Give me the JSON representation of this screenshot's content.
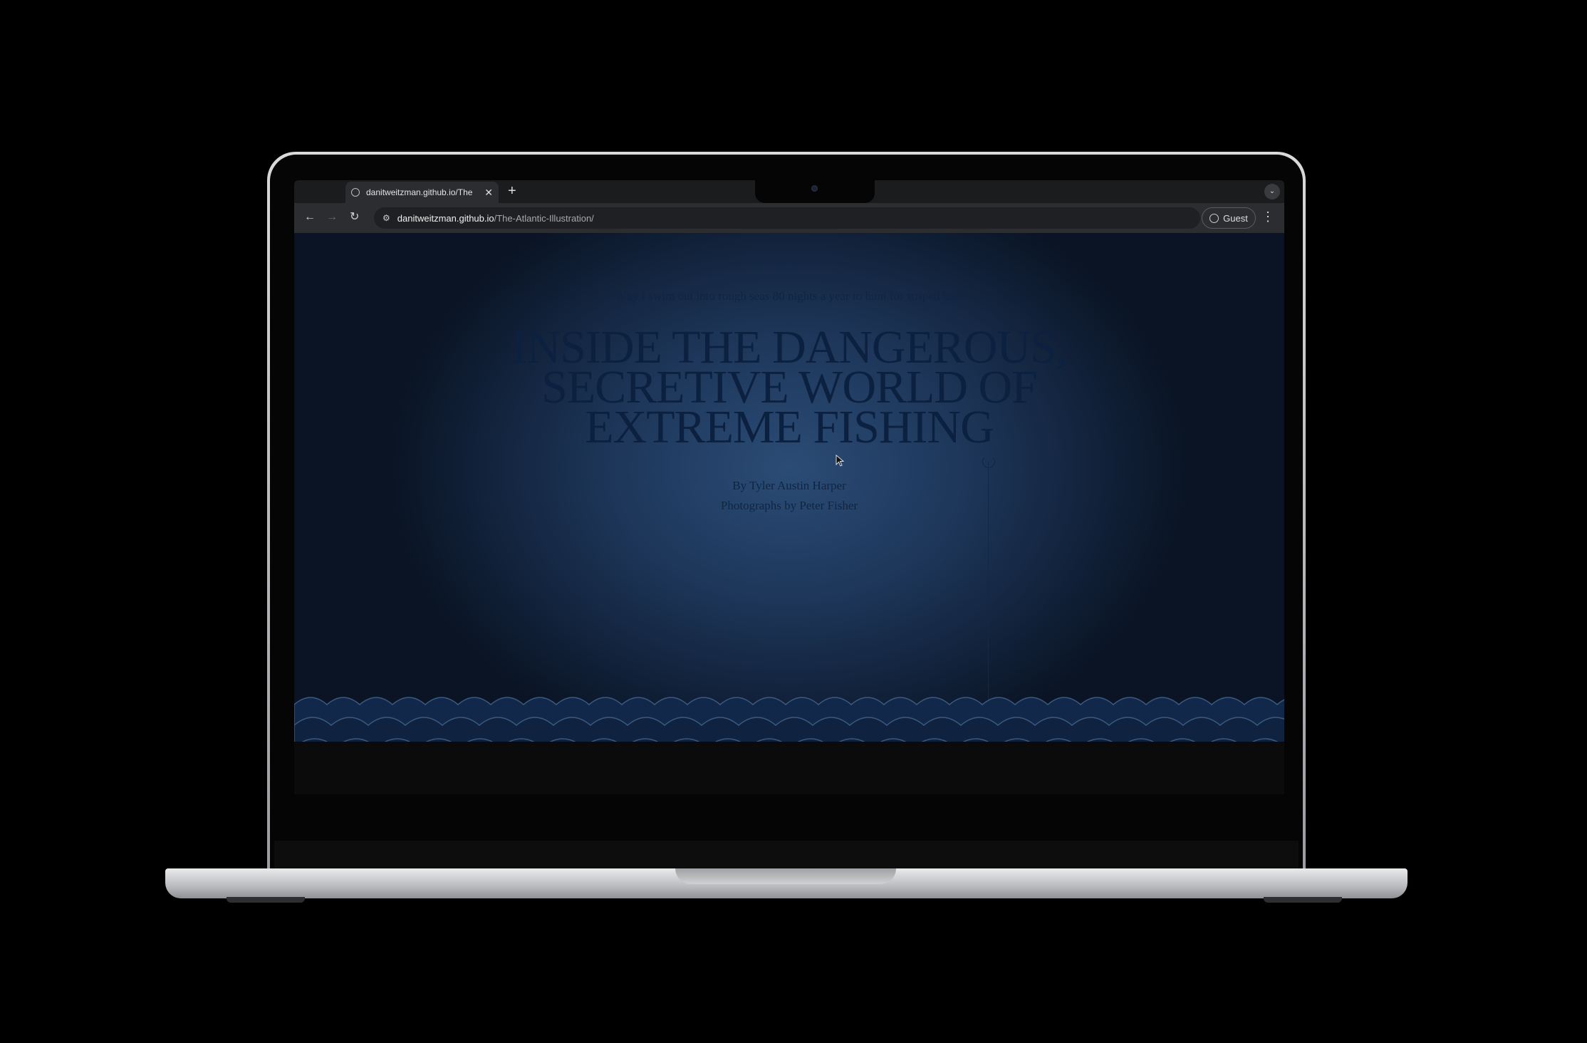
{
  "browser": {
    "tab_title": "danitweitzman.github.io/The",
    "new_tab_label": "+",
    "url_host": "danitweitzman.github.io",
    "url_path": "/The-Atlantic-Illustration/",
    "profile_label": "Guest"
  },
  "article": {
    "dek": "Why I swim out into rough seas 80 nights a year to hunt for striped bass",
    "headline_lines": [
      "INSIDE THE DANGEROUS,",
      "SECRETIVE WORLD OF",
      "EXTREME FISHING"
    ],
    "byline": "By Tyler Austin Harper",
    "photo_credit": "Photographs by Peter Fisher"
  },
  "colors": {
    "page_glow": "#2b4c76",
    "page_edge": "#0a1424",
    "headline_text": "#0c2140",
    "wave_crest": "#3a5a80"
  }
}
